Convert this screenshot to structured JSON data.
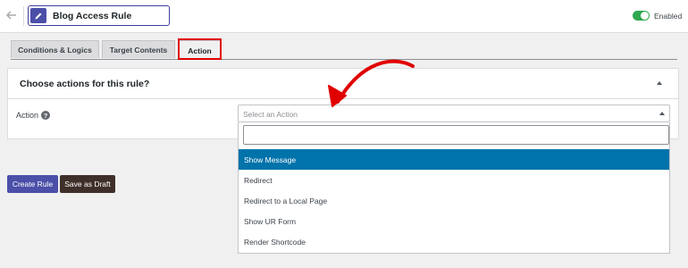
{
  "header": {
    "title": "Blog Access Rule",
    "status_label": "Enabled",
    "enabled": true,
    "icons": {
      "back": "arrow-left-icon",
      "edit": "pencil-icon"
    }
  },
  "tabs": [
    {
      "label": "Conditions & Logics",
      "active": false
    },
    {
      "label": "Target Contents",
      "active": false
    },
    {
      "label": "Action",
      "active": true
    }
  ],
  "panel": {
    "title": "Choose actions for this rule?",
    "field_label": "Action",
    "help_glyph": "?",
    "select": {
      "placeholder": "Select an Action",
      "search_value": "",
      "options": [
        {
          "label": "Show Message",
          "highlighted": true
        },
        {
          "label": "Redirect",
          "highlighted": false
        },
        {
          "label": "Redirect to a Local Page",
          "highlighted": false
        },
        {
          "label": "Show UR Form",
          "highlighted": false
        },
        {
          "label": "Render Shortcode",
          "highlighted": false
        }
      ]
    }
  },
  "buttons": {
    "create_label": "Create Rule",
    "draft_label": "Save as Draft"
  },
  "colors": {
    "accent": "#4b4fa8",
    "toggle_on": "#2fa84f",
    "option_highlight": "#0073aa",
    "draft_button": "#3f2f2a",
    "annotation_red": "#e00000"
  }
}
